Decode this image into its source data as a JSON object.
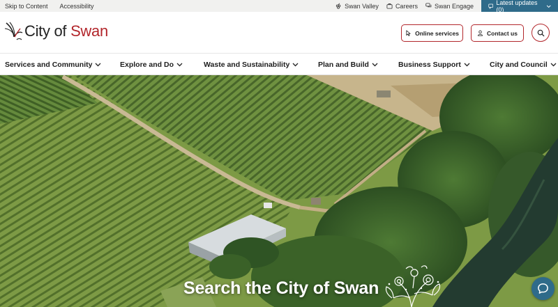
{
  "utility": {
    "skip_link": "Skip to Content",
    "accessibility_link": "Accessibility",
    "swan_valley_link": "Swan Valley",
    "careers_link": "Careers",
    "swan_engage_link": "Swan Engage",
    "latest_updates_label": "Latest updates (0)"
  },
  "header": {
    "logo_city": "City of",
    "logo_swan": "Swan",
    "online_services_label": "Online services",
    "contact_us_label": "Contact us"
  },
  "nav": {
    "items": [
      {
        "label": "Services and Community"
      },
      {
        "label": "Explore and Do"
      },
      {
        "label": "Waste and Sustainability"
      },
      {
        "label": "Plan and Build"
      },
      {
        "label": "Business Support"
      },
      {
        "label": "City and Council"
      }
    ]
  },
  "hero": {
    "title": "Search the City of Swan"
  },
  "colors": {
    "brand_red": "#b2262b",
    "accent_teal": "#2f6b8a",
    "utility_bg": "#f1f1ef"
  },
  "icons": {
    "swan_valley": "grape-icon",
    "careers": "briefcase-icon",
    "swan_engage": "chat-bubbles-icon",
    "latest_updates": "message-icon",
    "online_services": "cursor-icon",
    "contact_us": "person-icon",
    "search": "search-icon",
    "chat": "chat-icon"
  }
}
